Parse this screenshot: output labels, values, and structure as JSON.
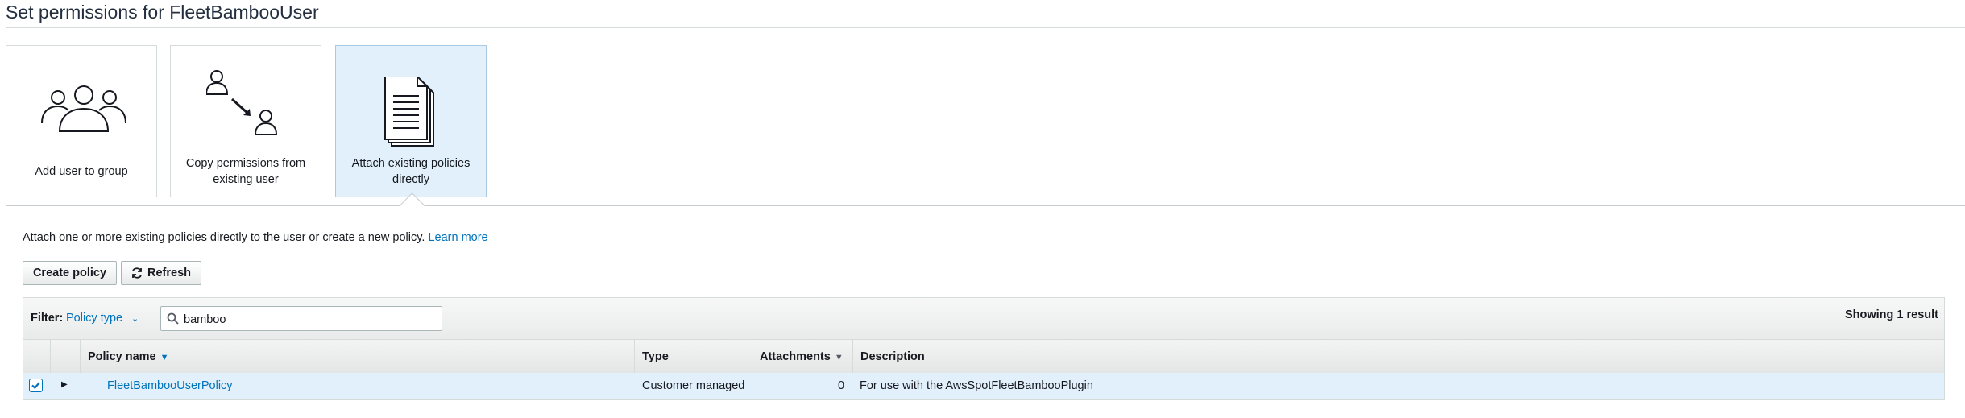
{
  "page": {
    "title": "Set permissions for FleetBambooUser"
  },
  "options": [
    {
      "label": "Add user to group",
      "icon": "users-group-icon"
    },
    {
      "label_line1": "Copy permissions from",
      "label_line2": "existing user",
      "icon": "copy-user-icon"
    },
    {
      "label_line1": "Attach existing policies",
      "label_line2": "directly",
      "icon": "document-stack-icon",
      "selected": true
    }
  ],
  "intro": {
    "text": "Attach one or more existing policies directly to the user or create a new policy.",
    "link": "Learn more"
  },
  "toolbar": {
    "create_label": "Create policy",
    "refresh_label": "Refresh"
  },
  "filter": {
    "label": "Filter:",
    "type": "Policy type",
    "search_value": "bamboo",
    "result_text": "Showing 1 result"
  },
  "table": {
    "columns": [
      "Policy name",
      "Type",
      "Attachments",
      "Description"
    ],
    "rows": [
      {
        "checked": true,
        "name": "FleetBambooUserPolicy",
        "type": "Customer managed",
        "attachments": "0",
        "description": "For use with the AwsSpotFleetBambooPlugin"
      }
    ]
  },
  "colors": {
    "link": "#0073bb",
    "selected_bg": "#e1f0fb",
    "border": "#d5dbdb"
  }
}
